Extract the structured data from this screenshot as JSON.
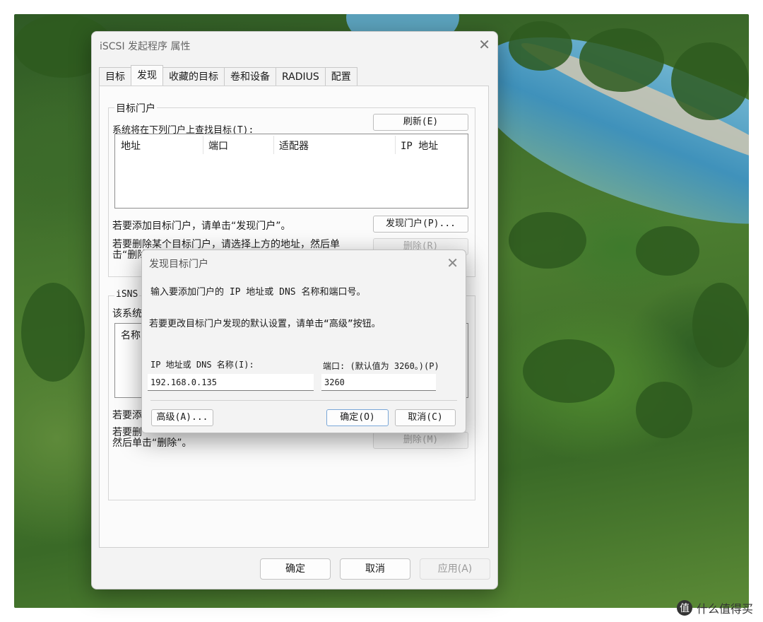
{
  "window": {
    "title": "iSCSI 发起程序 属性",
    "close_glyph": "✕",
    "tabs": [
      "目标",
      "发现",
      "收藏的目标",
      "卷和设备",
      "RADIUS",
      "配置"
    ],
    "active_tab": 1
  },
  "discovery": {
    "target_portals_legend": "目标门户",
    "search_text": "系统将在下列门户上查找目标(T):",
    "refresh_button": "刷新(E)",
    "columns": [
      "地址",
      "端口",
      "适配器",
      "IP 地址"
    ],
    "add_hint": "若要添加目标门户，请单击“发现门户”。",
    "discover_button": "发现门户(P)...",
    "remove_hint_line1": "若要删除某个目标门户，请选择上方的地址，然后单",
    "remove_hint_line2": "击“删除”。",
    "remove_button": "删除(R)",
    "isns_legend": "iSNS",
    "isns_text_fragment": "该系统",
    "isns_column_fragment": "名称",
    "isns_add_fragment": "若要添",
    "isns_remove_fragment": "若要删",
    "isns_remove_line2": "然后单击“删除”。",
    "isns_remove_button": "删除(M)"
  },
  "footer": {
    "ok": "确定",
    "cancel": "取消",
    "apply": "应用(A)"
  },
  "dialog": {
    "title": "发现目标门户",
    "close_glyph": "✕",
    "instruction": "输入要添加门户的 IP 地址或 DNS 名称和端口号。",
    "advanced_hint": "若要更改目标门户发现的默认设置，请单击“高级”按钮。",
    "ip_label": "IP 地址或 DNS 名称(I):",
    "ip_value": "192.168.0.135",
    "port_label": "端口: (默认值为 3260。)(P)",
    "port_value": "3260",
    "advanced_button": "高级(A)...",
    "ok_button": "确定(O)",
    "cancel_button": "取消(C)"
  },
  "watermark": {
    "glyph": "值",
    "text": "什么值得买"
  }
}
